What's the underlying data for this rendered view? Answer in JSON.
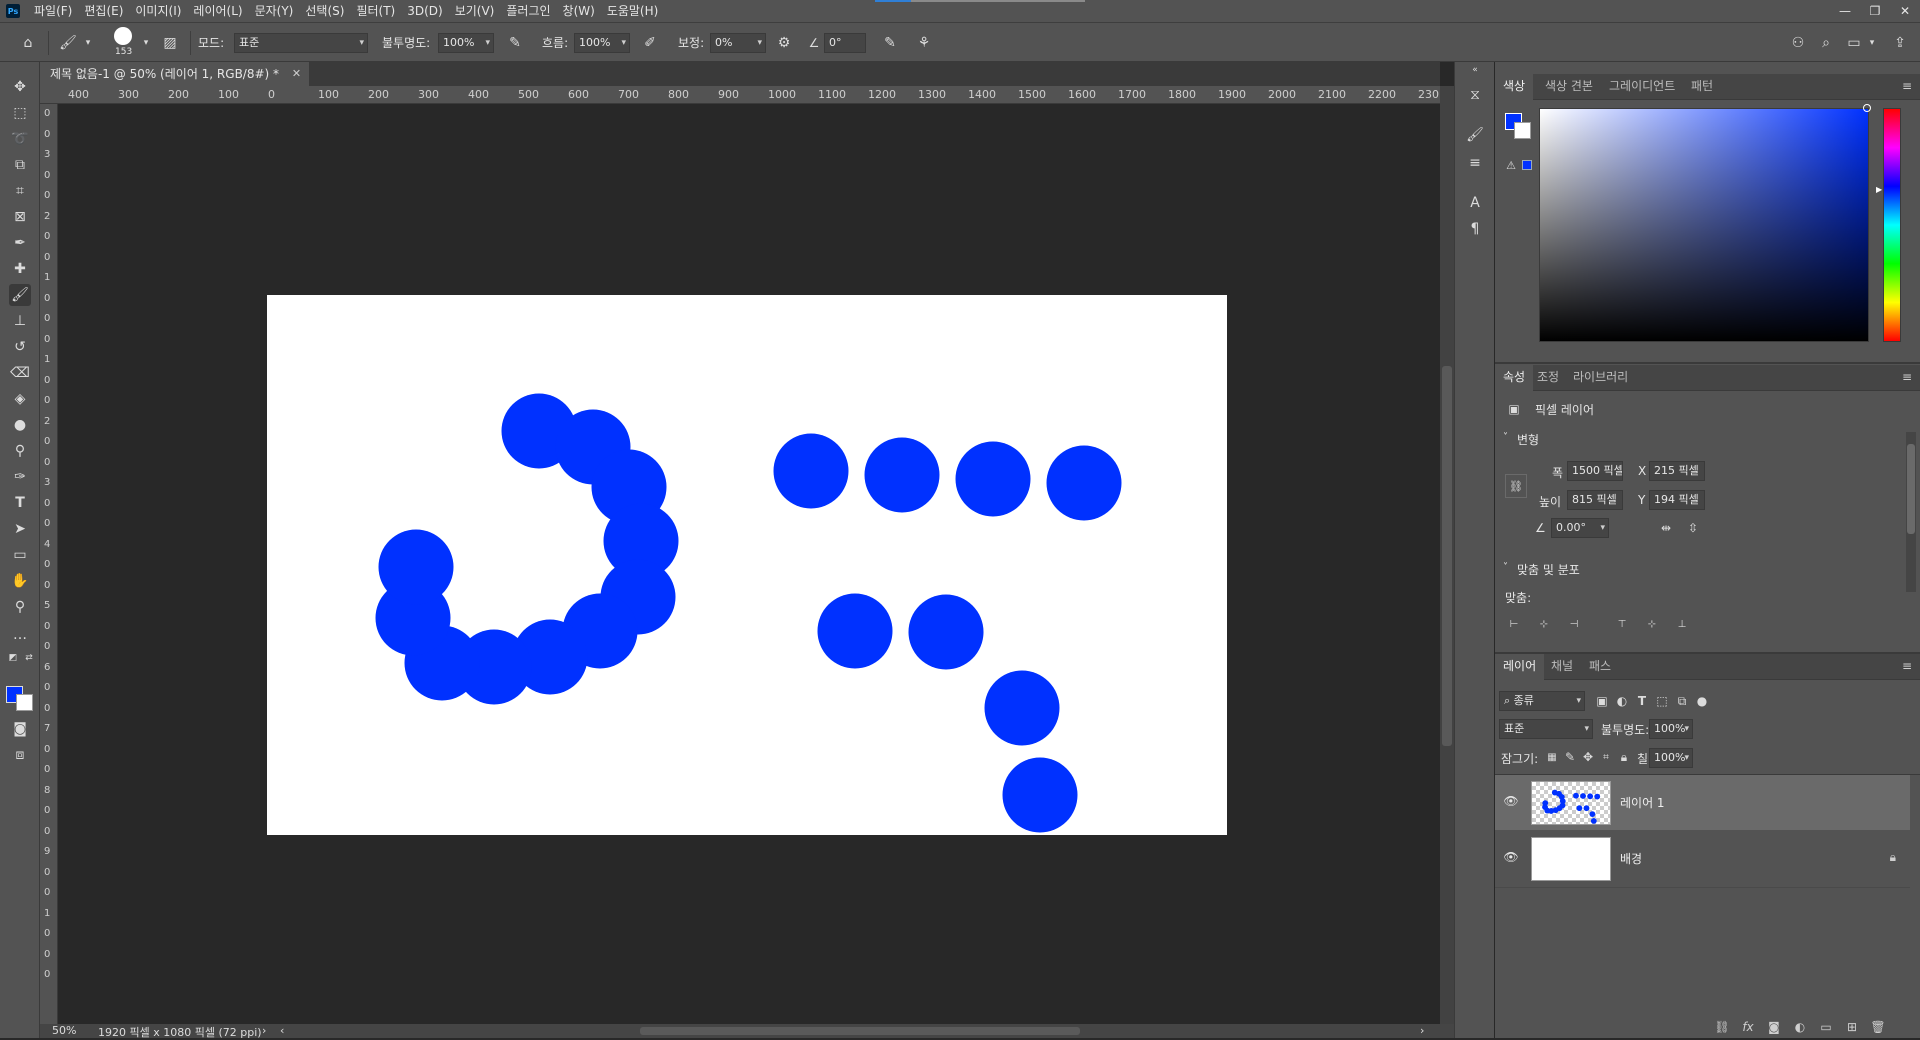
{
  "app": {
    "logo": "Ps",
    "menu": [
      "파일(F)",
      "편집(E)",
      "이미지(I)",
      "레이어(L)",
      "문자(Y)",
      "선택(S)",
      "필터(T)",
      "3D(D)",
      "보기(V)",
      "플러그인",
      "창(W)",
      "도움말(H)"
    ],
    "window_controls": [
      "minimize-icon",
      "restore-icon",
      "close-icon"
    ]
  },
  "options_bar": {
    "brush_size": "153",
    "mode_label": "모드:",
    "mode_value": "표준",
    "opacity_label": "불투명도:",
    "opacity_value": "100%",
    "flow_label": "흐름:",
    "flow_value": "100%",
    "smoothing_label": "보정:",
    "smoothing_value": "0%",
    "angle_value": "0°",
    "icons": [
      "home-icon",
      "brush-icon",
      "brush-settings-icon",
      "pressure-opacity-icon",
      "airbrush-icon",
      "gear-icon",
      "angle-icon",
      "pressure-size-icon",
      "symmetry-icon",
      "share-icon",
      "search-icon",
      "workspace-icon",
      "export-icon"
    ]
  },
  "document": {
    "tab_title": "제목 없음-1 @ 50% (레이어 1, RGB/8#) *",
    "ruler_h": [
      "400",
      "300",
      "200",
      "100",
      "0",
      "100",
      "200",
      "300",
      "400",
      "500",
      "600",
      "700",
      "800",
      "900",
      "1000",
      "1100",
      "1200",
      "1300",
      "1400",
      "1500",
      "1600",
      "1700",
      "1800",
      "1900",
      "2000",
      "2100",
      "2200",
      "230"
    ],
    "ruler_v": [
      "0",
      "0",
      "3",
      "0",
      "0",
      "2",
      "0",
      "0",
      "1",
      "0",
      "0",
      "0",
      "1",
      "0",
      "0",
      "2",
      "0",
      "0",
      "3",
      "0",
      "0",
      "4",
      "0",
      "0",
      "5",
      "0",
      "0",
      "6",
      "0",
      "0",
      "7",
      "0",
      "0",
      "8",
      "0",
      "0",
      "9",
      "0",
      "0",
      "1",
      "0",
      "0",
      "0"
    ],
    "zoom": "50%",
    "doc_info": "1920 픽셀 x 1080 픽셀 (72 ppi)",
    "canvas_color": "#ffffff",
    "paint_color": "#0031ff",
    "dot_count": 21
  },
  "tools": [
    "move-icon",
    "marquee-icon",
    "lasso-icon",
    "object-select-icon",
    "crop-icon",
    "frame-icon",
    "eyedropper-icon",
    "healing-brush-icon",
    "brush-icon",
    "clone-stamp-icon",
    "history-brush-icon",
    "eraser-icon",
    "paint-bucket-icon",
    "blur-icon",
    "dodge-icon",
    "pen-icon",
    "type-icon",
    "path-select-icon",
    "rectangle-icon",
    "hand-icon",
    "zoom-icon",
    "more-tools-icon"
  ],
  "colors": {
    "foreground": "#0031ff",
    "background": "#ffffff"
  },
  "color_panel": {
    "tabs": [
      "색상",
      "색상 견본",
      "그레이디언트",
      "패턴"
    ],
    "active_tab": "색상"
  },
  "properties_panel": {
    "tabs": [
      "속성",
      "조정",
      "라이브러리"
    ],
    "active_tab": "속성",
    "layer_kind": "픽셀 레이어",
    "transform_header": "변형",
    "width_label": "폭",
    "width_value": "1500 픽셀",
    "height_label": "높이",
    "height_value": "815 픽셀",
    "x_label": "X",
    "x_value": "215 픽셀",
    "y_label": "Y",
    "y_value": "194 픽셀",
    "angle_value": "0.00°",
    "align_header": "맞춤 및 분포",
    "align_label": "맞춤:"
  },
  "layers_panel": {
    "tabs": [
      "레이어",
      "채널",
      "패스"
    ],
    "active_tab": "레이어",
    "filter_kind": "종류",
    "blend_mode": "표준",
    "opacity_label": "불투명도:",
    "opacity_value": "100%",
    "lock_label": "잠그기:",
    "fill_label": "칠:",
    "fill_value": "100%",
    "layers": [
      {
        "name": "레이어 1",
        "selected": true,
        "locked": false
      },
      {
        "name": "배경",
        "selected": false,
        "locked": true
      }
    ],
    "footer_icons": [
      "link-icon",
      "fx-icon",
      "mask-icon",
      "adjustment-icon",
      "group-icon",
      "new-layer-icon",
      "trash-icon"
    ]
  }
}
